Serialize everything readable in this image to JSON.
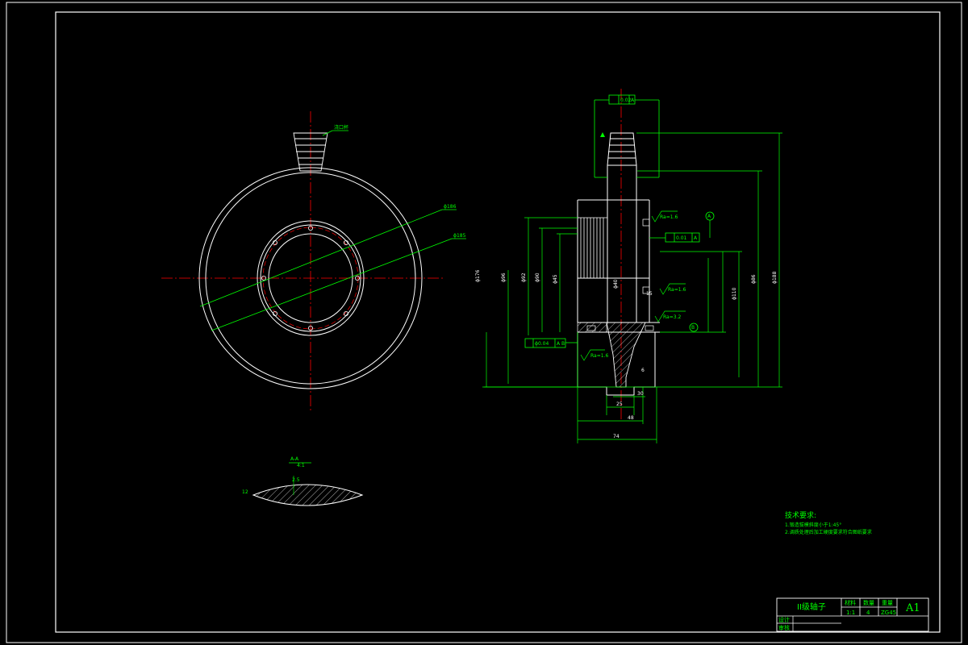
{
  "drawing": {
    "sprue_label": "浇口杯",
    "front_view_dims": {
      "d_outer": "ϕ186",
      "d_inner": "ϕ185"
    },
    "section_detail": {
      "title": "A-A",
      "scale": "4:1",
      "width": "12",
      "height": "2.5"
    },
    "side_view": {
      "tolerance_top": "0.02",
      "tolerance_top_datum": "A",
      "tolerance_mid": "0.01",
      "tolerance_mid_datum": "A",
      "tolerance_low": "ϕ0.04",
      "tolerance_low_datum": "A B",
      "datum_a": "A",
      "datum_b": "B",
      "roughness_1": "Ra=1.6",
      "roughness_2": "Ra=1.6",
      "roughness_3": "Ra=3.2",
      "roughness_4": "Ra=1.6",
      "dim_74": "74",
      "dim_48": "48",
      "dim_30": "30",
      "dim_25": "25",
      "dim_15": "15",
      "dim_6": "6",
      "dim_d176": "ϕ176",
      "dim_d96": "ϕ96",
      "dim_d92": "ϕ92",
      "dim_d90": "ϕ90",
      "dim_d45": "ϕ45",
      "dim_d40": "ϕ40",
      "dim_d110": "ϕ110",
      "dim_d86": "ϕ86",
      "dim_d188": "ϕ188"
    }
  },
  "tech_requirements": {
    "title": "技术要求:",
    "items": [
      "1.锻造拔模斜度小于1:45°",
      "2.调质处理后加工硬度要求符合图纸要求"
    ]
  },
  "title_block": {
    "name": "II级轴子",
    "material_label": "材料",
    "material_value": "1:1",
    "quantity_label": "数量",
    "quantity_value": "4",
    "weight_label": "重量",
    "weight_value": "ZG45",
    "sheet_size": "A1",
    "designer_label": "设计",
    "checker_label": "审核"
  }
}
